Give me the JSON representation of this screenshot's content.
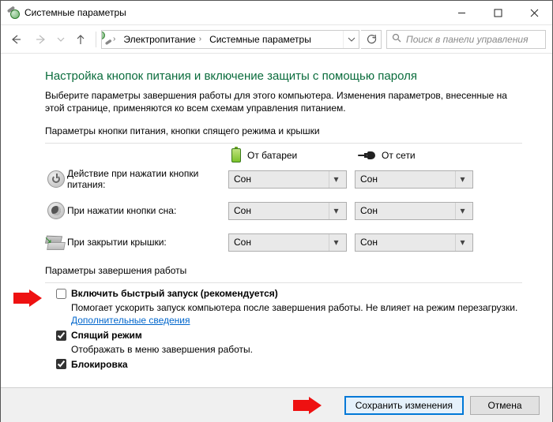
{
  "window": {
    "title": "Системные параметры"
  },
  "nav": {
    "back": "Назад",
    "forward": "Вперёд",
    "up": "Вверх"
  },
  "breadcrumbs": {
    "b1": "Электропитание",
    "b2": "Системные параметры"
  },
  "search": {
    "placeholder": "Поиск в панели управления"
  },
  "page": {
    "heading": "Настройка кнопок питания и включение защиты с помощью пароля",
    "intro": "Выберите параметры завершения работы для этого компьютера. Изменения параметров, внесенные на этой странице, применяются ко всем схемам управления питанием.",
    "buttonsHeading": "Параметры кнопки питания, кнопки спящего режима и крышки"
  },
  "columns": {
    "battery": "От батареи",
    "plugged": "От сети"
  },
  "rows": {
    "power": {
      "label": "Действие при нажатии кнопки питания:",
      "battery": "Сон",
      "plugged": "Сон"
    },
    "sleep": {
      "label": "При нажатии кнопки сна:",
      "battery": "Сон",
      "plugged": "Сон"
    },
    "lid": {
      "label": "При закрытии крышки:",
      "battery": "Сон",
      "plugged": "Сон"
    }
  },
  "shutdown": {
    "heading": "Параметры завершения работы",
    "fast": {
      "label": "Включить быстрый запуск (рекомендуется)",
      "desc": "Помогает ускорить запуск компьютера после завершения работы. Не влияет на режим перезагрузки.",
      "link": "Дополнительные сведения"
    },
    "sleep": {
      "label": "Спящий режим",
      "desc": "Отображать в меню завершения работы."
    },
    "lock": {
      "label": "Блокировка"
    }
  },
  "footer": {
    "save": "Сохранить изменения",
    "cancel": "Отмена"
  }
}
